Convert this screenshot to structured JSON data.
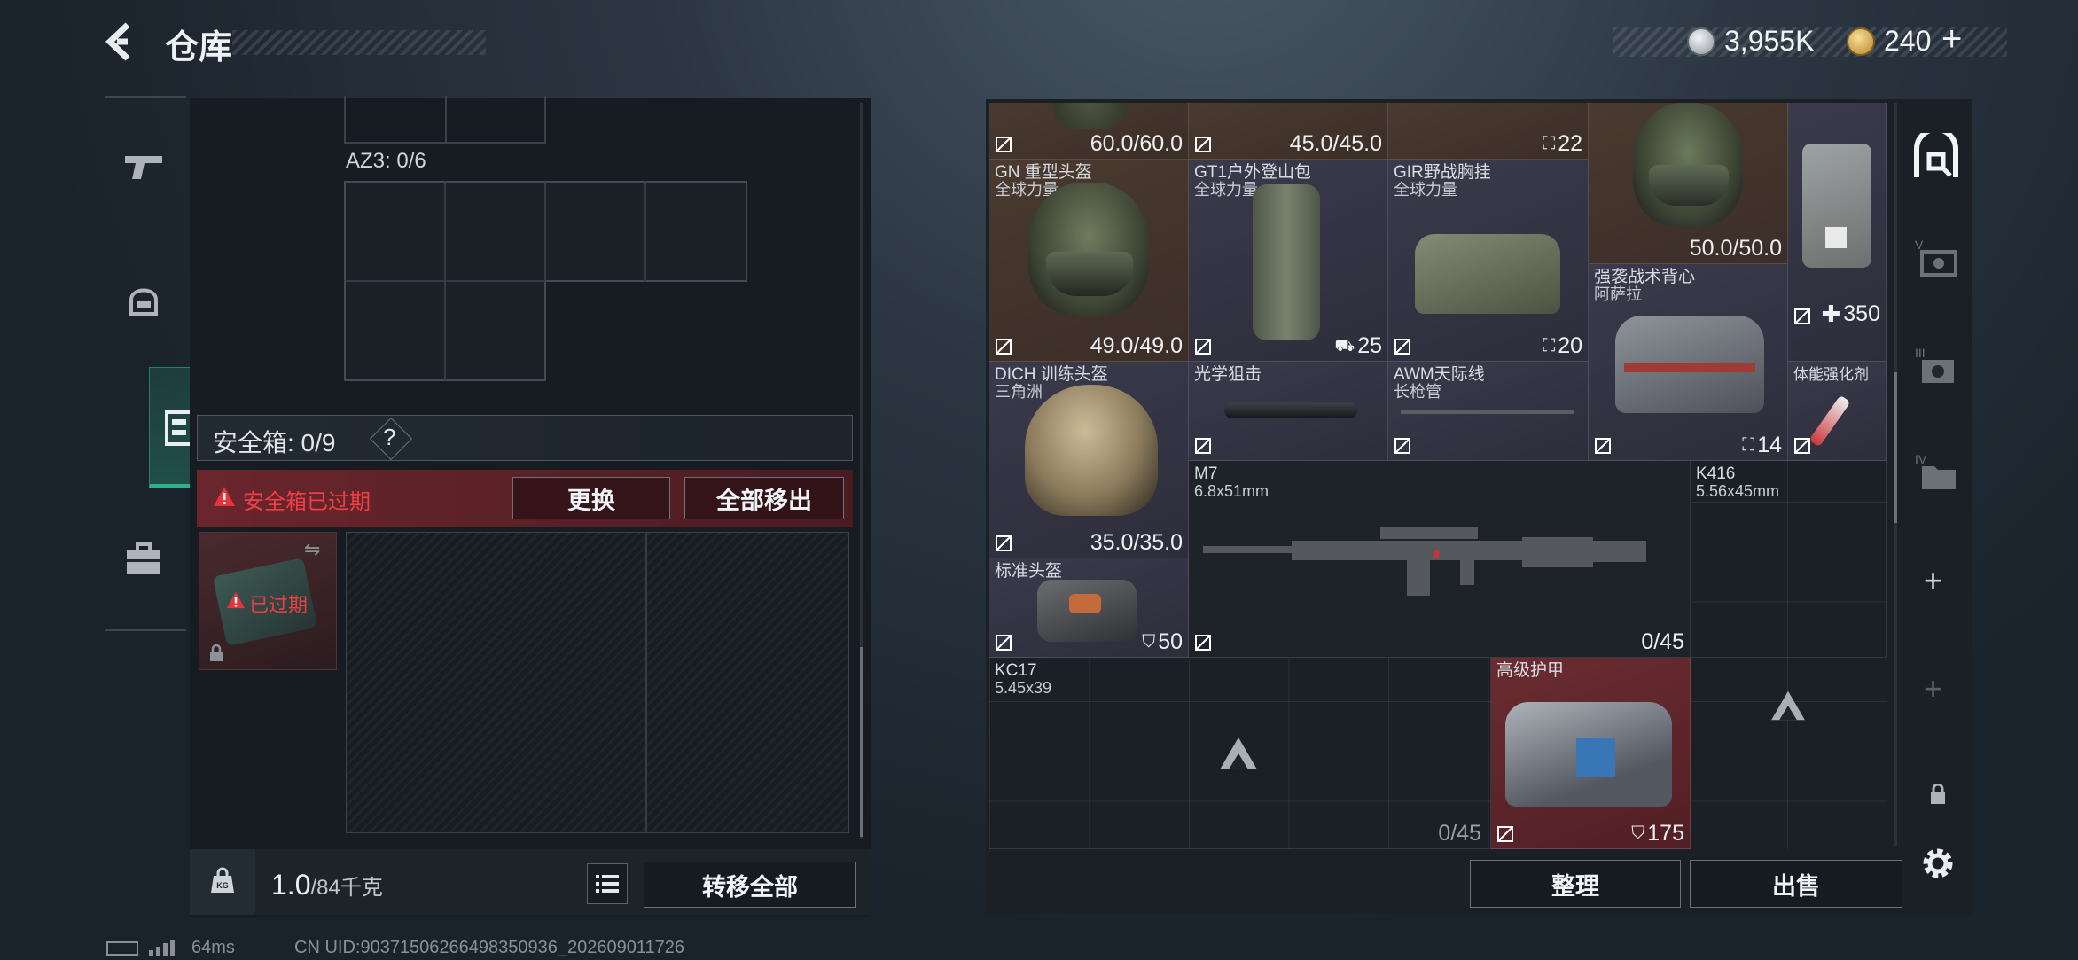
{
  "header": {
    "title": "仓库",
    "currency1": "3,955K",
    "currency2": "240",
    "plus": "+"
  },
  "left": {
    "az3_label": "AZ3: 0/6",
    "safe_label": "安全箱: 0/9",
    "help": "?",
    "expired_warning": "安全箱已过期",
    "replace_button": "更换",
    "move_all_button": "全部移出",
    "slot_expired": "已过期",
    "weight_value": "1.0",
    "weight_max": "/84千克",
    "transfer_all_button": "转移全部",
    "kg": "KG"
  },
  "items": [
    {
      "value": "60.0/60.0"
    },
    {
      "value": "45.0/45.0"
    },
    {
      "value": "22"
    },
    {
      "value": "50.0/50.0"
    },
    {
      "name": "GN 重型头盔",
      "sub": "全球力量",
      "value": "49.0/49.0"
    },
    {
      "name": "GT1户外登山包",
      "sub": "全球力量",
      "value": "25"
    },
    {
      "name": "GIR野战胸挂",
      "sub": "全球力量",
      "value": "20"
    },
    {
      "name": "强袭战术背心",
      "sub": "阿萨拉",
      "value": "14"
    },
    {
      "name": "",
      "value": "350"
    },
    {
      "name": "DICH 训练头盔",
      "sub": "三角洲",
      "value": "35.0/35.0"
    },
    {
      "name": "光学狙击"
    },
    {
      "name": "AWM天际线",
      "sub": "长枪管"
    },
    {
      "name": "体能强化剂"
    },
    {
      "name": "M7",
      "sub": "6.8x51mm",
      "value": "0/45"
    },
    {
      "name": "K416",
      "sub": "5.56x45mm"
    },
    {
      "name": "标准头盔",
      "value": "50"
    },
    {
      "name": "KC17",
      "sub": "5.45x39",
      "value": "0/45"
    },
    {
      "name": "高级护甲",
      "value": "175"
    }
  ],
  "right": {
    "sort_button": "整理",
    "sell_button": "出售"
  },
  "rail": {
    "roman3": "III",
    "roman4": "IV",
    "roman5": "V",
    "plus": "+"
  },
  "footer": {
    "ping": "64ms",
    "uid": "CN UID:90371506266498350936_202609011726"
  },
  "colors": {
    "accent": "#2fae87",
    "danger": "#d8393d",
    "item_red": "#5c2228",
    "item_brown": "#45362c",
    "item_purple": "#353547"
  },
  "icons": [
    "back-arrow-icon",
    "silver-coin-icon",
    "gold-coin-icon",
    "pistol-icon",
    "helmet-icon",
    "vest-icon",
    "briefcase-icon",
    "lock-icon",
    "list-icon",
    "warning-icon",
    "transfer-icon",
    "no-sell-icon",
    "backpack-icon",
    "shield-icon",
    "gear-icon"
  ]
}
